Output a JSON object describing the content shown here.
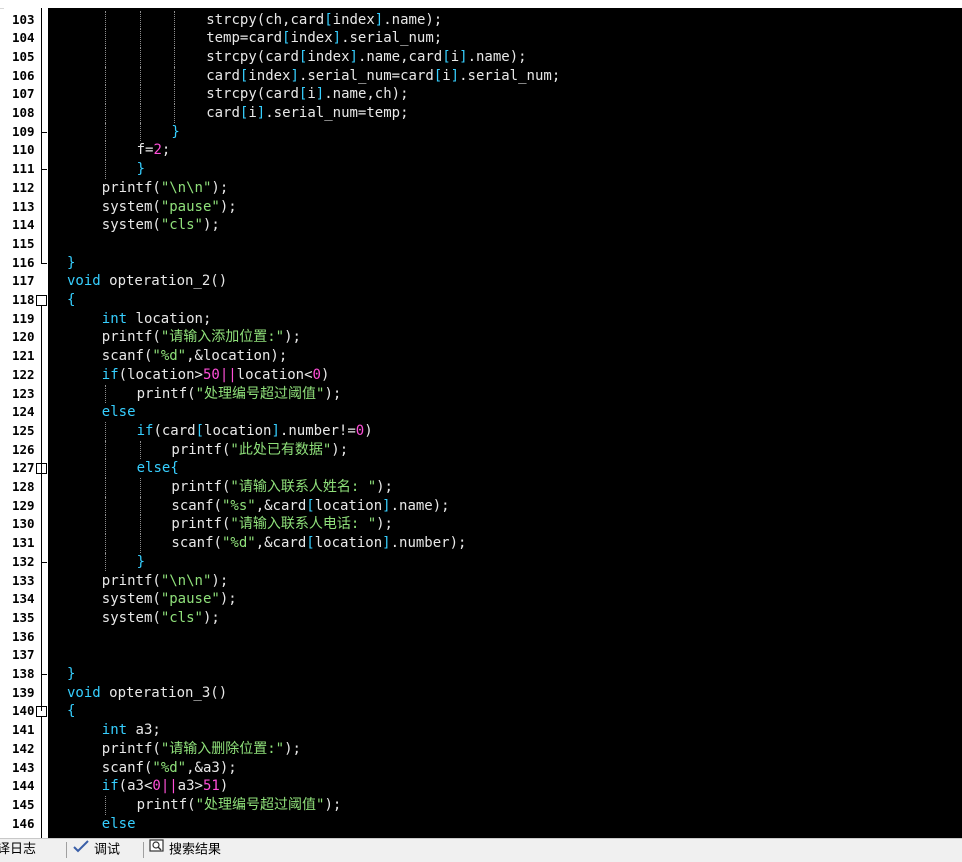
{
  "lines": [
    {
      "n": "103",
      "indent": 4,
      "code": [
        [
          "id",
          "strcpy"
        ],
        [
          "id",
          "(ch,card"
        ],
        [
          "br",
          "["
        ],
        [
          "id",
          "index"
        ],
        [
          "br",
          "]"
        ],
        [
          "id",
          ".name);"
        ]
      ]
    },
    {
      "n": "104",
      "indent": 4,
      "code": [
        [
          "id",
          "temp=card"
        ],
        [
          "br",
          "["
        ],
        [
          "id",
          "index"
        ],
        [
          "br",
          "]"
        ],
        [
          "id",
          ".serial_num;"
        ]
      ]
    },
    {
      "n": "105",
      "indent": 4,
      "code": [
        [
          "id",
          "strcpy"
        ],
        [
          "id",
          "(card"
        ],
        [
          "br",
          "["
        ],
        [
          "id",
          "index"
        ],
        [
          "br",
          "]"
        ],
        [
          "id",
          ".name,card"
        ],
        [
          "br",
          "["
        ],
        [
          "id",
          "i"
        ],
        [
          "br",
          "]"
        ],
        [
          "id",
          ".name);"
        ]
      ]
    },
    {
      "n": "106",
      "indent": 4,
      "code": [
        [
          "id",
          "card"
        ],
        [
          "br",
          "["
        ],
        [
          "id",
          "index"
        ],
        [
          "br",
          "]"
        ],
        [
          "id",
          ".serial_num=card"
        ],
        [
          "br",
          "["
        ],
        [
          "id",
          "i"
        ],
        [
          "br",
          "]"
        ],
        [
          "id",
          ".serial_num;"
        ]
      ]
    },
    {
      "n": "107",
      "indent": 4,
      "code": [
        [
          "id",
          "strcpy"
        ],
        [
          "id",
          "(card"
        ],
        [
          "br",
          "["
        ],
        [
          "id",
          "i"
        ],
        [
          "br",
          "]"
        ],
        [
          "id",
          ".name,ch);"
        ]
      ]
    },
    {
      "n": "108",
      "indent": 4,
      "code": [
        [
          "id",
          "card"
        ],
        [
          "br",
          "["
        ],
        [
          "id",
          "i"
        ],
        [
          "br",
          "]"
        ],
        [
          "id",
          ".serial_num=temp;"
        ]
      ]
    },
    {
      "n": "109",
      "indent": 3,
      "code": [
        [
          "br",
          "}"
        ]
      ]
    },
    {
      "n": "110",
      "indent": 2,
      "code": [
        [
          "id",
          "f="
        ],
        [
          "num",
          "2"
        ],
        [
          "id",
          ";"
        ]
      ]
    },
    {
      "n": "111",
      "indent": 2,
      "code": [
        [
          "br",
          "}"
        ]
      ]
    },
    {
      "n": "112",
      "indent": 1,
      "code": [
        [
          "id",
          "printf"
        ],
        [
          "id",
          "("
        ],
        [
          "str",
          "\"\\n\\n\""
        ],
        [
          "id",
          ");"
        ]
      ]
    },
    {
      "n": "113",
      "indent": 1,
      "code": [
        [
          "id",
          "system"
        ],
        [
          "id",
          "("
        ],
        [
          "str",
          "\"pause\""
        ],
        [
          "id",
          ");"
        ]
      ]
    },
    {
      "n": "114",
      "indent": 1,
      "code": [
        [
          "id",
          "system"
        ],
        [
          "id",
          "("
        ],
        [
          "str",
          "\"cls\""
        ],
        [
          "id",
          ");"
        ]
      ]
    },
    {
      "n": "115",
      "indent": 0,
      "code": []
    },
    {
      "n": "116",
      "indent": 0,
      "code": [
        [
          "br",
          "}"
        ]
      ]
    },
    {
      "n": "117",
      "indent": 0,
      "code": [
        [
          "kw",
          "void"
        ],
        [
          "id",
          " opteration_2()"
        ]
      ]
    },
    {
      "n": "118",
      "indent": 0,
      "code": [
        [
          "br",
          "{"
        ]
      ]
    },
    {
      "n": "119",
      "indent": 1,
      "code": [
        [
          "kw",
          "int"
        ],
        [
          "id",
          " location;"
        ]
      ]
    },
    {
      "n": "120",
      "indent": 1,
      "code": [
        [
          "id",
          "printf"
        ],
        [
          "id",
          "("
        ],
        [
          "str",
          "\"请输入添加位置:\""
        ],
        [
          "id",
          ");"
        ]
      ]
    },
    {
      "n": "121",
      "indent": 1,
      "code": [
        [
          "id",
          "scanf"
        ],
        [
          "id",
          "("
        ],
        [
          "str",
          "\"%d\""
        ],
        [
          "id",
          ",&location);"
        ]
      ]
    },
    {
      "n": "122",
      "indent": 1,
      "code": [
        [
          "kw",
          "if"
        ],
        [
          "id",
          "(location>"
        ],
        [
          "num",
          "50"
        ],
        [
          "op",
          "||"
        ],
        [
          "id",
          "location<"
        ],
        [
          "num",
          "0"
        ],
        [
          "id",
          ")"
        ]
      ]
    },
    {
      "n": "123",
      "indent": 2,
      "code": [
        [
          "id",
          "printf"
        ],
        [
          "id",
          "("
        ],
        [
          "str",
          "\"处理编号超过阈值\""
        ],
        [
          "id",
          ");"
        ]
      ]
    },
    {
      "n": "124",
      "indent": 1,
      "code": [
        [
          "kw",
          "else"
        ]
      ]
    },
    {
      "n": "125",
      "indent": 2,
      "code": [
        [
          "kw",
          "if"
        ],
        [
          "id",
          "(card"
        ],
        [
          "br",
          "["
        ],
        [
          "id",
          "location"
        ],
        [
          "br",
          "]"
        ],
        [
          "id",
          ".number!="
        ],
        [
          "num",
          "0"
        ],
        [
          "id",
          ")"
        ]
      ]
    },
    {
      "n": "126",
      "indent": 3,
      "code": [
        [
          "id",
          "printf"
        ],
        [
          "id",
          "("
        ],
        [
          "str",
          "\"此处已有数据\""
        ],
        [
          "id",
          ");"
        ]
      ]
    },
    {
      "n": "127",
      "indent": 2,
      "code": [
        [
          "kw",
          "else"
        ],
        [
          "br",
          "{"
        ]
      ]
    },
    {
      "n": "128",
      "indent": 3,
      "code": [
        [
          "id",
          "printf"
        ],
        [
          "id",
          "("
        ],
        [
          "str",
          "\"请输入联系人姓名: \""
        ],
        [
          "id",
          ");"
        ]
      ]
    },
    {
      "n": "129",
      "indent": 3,
      "code": [
        [
          "id",
          "scanf"
        ],
        [
          "id",
          "("
        ],
        [
          "str",
          "\"%s\""
        ],
        [
          "id",
          ",&card"
        ],
        [
          "br",
          "["
        ],
        [
          "id",
          "location"
        ],
        [
          "br",
          "]"
        ],
        [
          "id",
          ".name);"
        ]
      ]
    },
    {
      "n": "130",
      "indent": 3,
      "code": [
        [
          "id",
          "printf"
        ],
        [
          "id",
          "("
        ],
        [
          "str",
          "\"请输入联系人电话: \""
        ],
        [
          "id",
          ");"
        ]
      ]
    },
    {
      "n": "131",
      "indent": 3,
      "code": [
        [
          "id",
          "scanf"
        ],
        [
          "id",
          "("
        ],
        [
          "str",
          "\"%d\""
        ],
        [
          "id",
          ",&card"
        ],
        [
          "br",
          "["
        ],
        [
          "id",
          "location"
        ],
        [
          "br",
          "]"
        ],
        [
          "id",
          ".number);"
        ]
      ]
    },
    {
      "n": "132",
      "indent": 2,
      "code": [
        [
          "br",
          "}"
        ]
      ]
    },
    {
      "n": "133",
      "indent": 1,
      "code": [
        [
          "id",
          "printf"
        ],
        [
          "id",
          "("
        ],
        [
          "str",
          "\"\\n\\n\""
        ],
        [
          "id",
          ");"
        ]
      ]
    },
    {
      "n": "134",
      "indent": 1,
      "code": [
        [
          "id",
          "system"
        ],
        [
          "id",
          "("
        ],
        [
          "str",
          "\"pause\""
        ],
        [
          "id",
          ");"
        ]
      ]
    },
    {
      "n": "135",
      "indent": 1,
      "code": [
        [
          "id",
          "system"
        ],
        [
          "id",
          "("
        ],
        [
          "str",
          "\"cls\""
        ],
        [
          "id",
          ");"
        ]
      ]
    },
    {
      "n": "136",
      "indent": 0,
      "code": []
    },
    {
      "n": "137",
      "indent": 0,
      "code": []
    },
    {
      "n": "138",
      "indent": 0,
      "code": [
        [
          "br",
          "}"
        ]
      ]
    },
    {
      "n": "139",
      "indent": 0,
      "code": [
        [
          "kw",
          "void"
        ],
        [
          "id",
          " opteration_3()"
        ]
      ]
    },
    {
      "n": "140",
      "indent": 0,
      "code": [
        [
          "br",
          "{"
        ]
      ]
    },
    {
      "n": "141",
      "indent": 1,
      "code": [
        [
          "kw",
          "int"
        ],
        [
          "id",
          " a3;"
        ]
      ]
    },
    {
      "n": "142",
      "indent": 1,
      "code": [
        [
          "id",
          "printf"
        ],
        [
          "id",
          "("
        ],
        [
          "str",
          "\"请输入删除位置:\""
        ],
        [
          "id",
          ");"
        ]
      ]
    },
    {
      "n": "143",
      "indent": 1,
      "code": [
        [
          "id",
          "scanf"
        ],
        [
          "id",
          "("
        ],
        [
          "str",
          "\"%d\""
        ],
        [
          "id",
          ",&a3);"
        ]
      ]
    },
    {
      "n": "144",
      "indent": 1,
      "code": [
        [
          "kw",
          "if"
        ],
        [
          "id",
          "(a3<"
        ],
        [
          "num",
          "0"
        ],
        [
          "op",
          "||"
        ],
        [
          "id",
          "a3>"
        ],
        [
          "num",
          "51"
        ],
        [
          "id",
          ")"
        ]
      ]
    },
    {
      "n": "145",
      "indent": 2,
      "code": [
        [
          "id",
          "printf"
        ],
        [
          "id",
          "("
        ],
        [
          "str",
          "\"处理编号超过阈值\""
        ],
        [
          "id",
          ");"
        ]
      ]
    },
    {
      "n": "146",
      "indent": 1,
      "code": [
        [
          "kw",
          "else"
        ]
      ]
    }
  ],
  "fold_markers": [
    "118",
    "127",
    "140"
  ],
  "bracket_ends": [
    "109",
    "111",
    "116",
    "132",
    "138"
  ],
  "bottom_tabs": {
    "compile_log": "编译日志",
    "debug": "调试",
    "search_results": "搜索结果"
  },
  "colors": {
    "editor_bg": "#000000",
    "keyword": "#36cfff",
    "string": "#8fe07a",
    "number": "#ff4fd8",
    "identifier": "#e8e8e8"
  }
}
